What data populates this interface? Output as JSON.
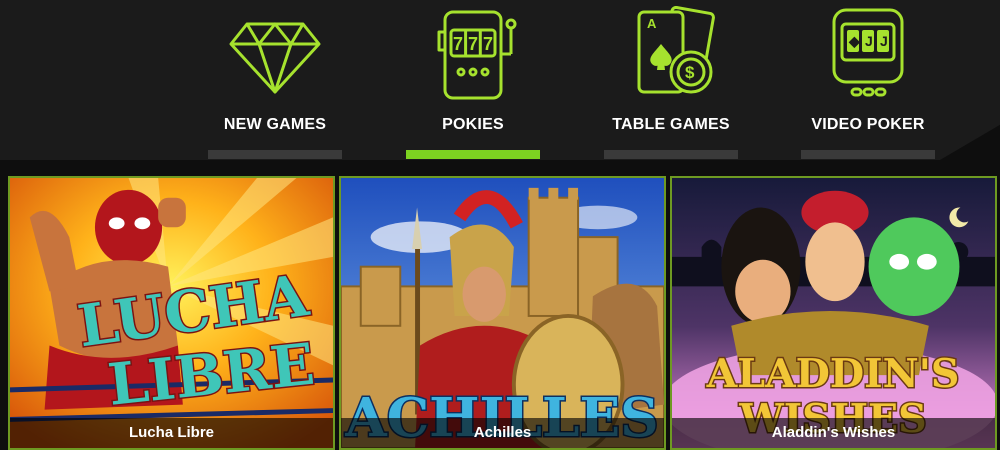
{
  "colors": {
    "accent": "#a6e22e",
    "active_bar": "#7dd321",
    "inactive_bar": "#3a3a3a",
    "nav_bg": "#1b1b1b"
  },
  "categories": [
    {
      "label": "NEW GAMES",
      "icon": "diamond-icon",
      "active": false
    },
    {
      "label": "POKIES",
      "icon": "slot-machine-icon",
      "active": true
    },
    {
      "label": "TABLE GAMES",
      "icon": "cards-chip-icon",
      "active": false
    },
    {
      "label": "VIDEO POKER",
      "icon": "video-poker-icon",
      "active": false
    }
  ],
  "games": [
    {
      "title": "Lucha Libre",
      "logo_text": "LUCHA LIBRE"
    },
    {
      "title": "Achilles",
      "logo_text": "ACHILLES"
    },
    {
      "title": "Aladdin's Wishes",
      "logo_text": "ALADDIN'S WISHES"
    }
  ]
}
